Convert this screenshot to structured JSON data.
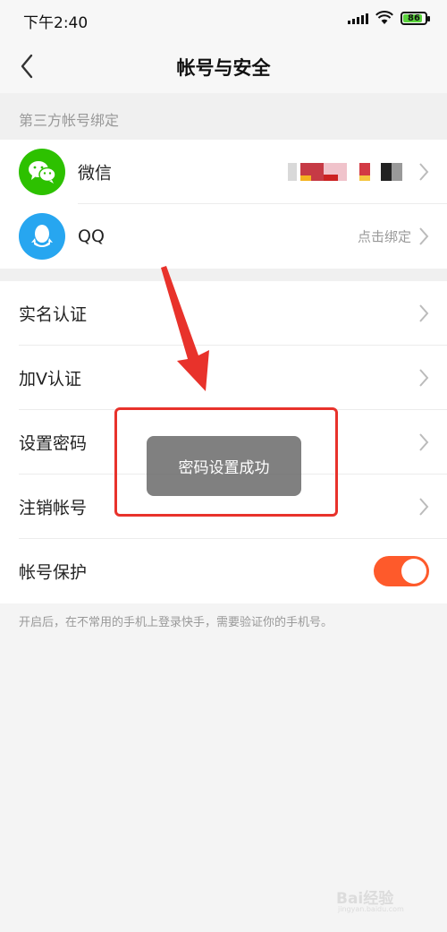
{
  "status_bar": {
    "time": "下午2:40",
    "battery": "86",
    "battery_level": 0.86,
    "icons": [
      "signal-icon",
      "wifi-icon",
      "battery-icon"
    ]
  },
  "nav": {
    "title": "帐号与安全",
    "back_icon": "chevron-left-icon"
  },
  "third_party": {
    "section_title": "第三方帐号绑定",
    "accounts": [
      {
        "label": "微信",
        "icon": "wechat-icon",
        "color": "#2dc100",
        "value": ""
      },
      {
        "label": "QQ",
        "icon": "qq-icon",
        "color": "#27a6f0",
        "value": "点击绑定"
      }
    ]
  },
  "settings": [
    {
      "label": "实名认证"
    },
    {
      "label": "加V认证"
    },
    {
      "label": "设置密码"
    },
    {
      "label": "注销帐号"
    }
  ],
  "protection": {
    "label": "帐号保护",
    "enabled": true,
    "toggle_color": "#fe5a2b",
    "footnote": "开启后，在不常用的手机上登录快手，需要验证你的手机号。"
  },
  "toast": {
    "message": "密码设置成功"
  },
  "annotation": {
    "color": "#e8322b"
  },
  "watermark": {
    "text": "Bai经验",
    "sub": "jingyan.baidu.com"
  }
}
